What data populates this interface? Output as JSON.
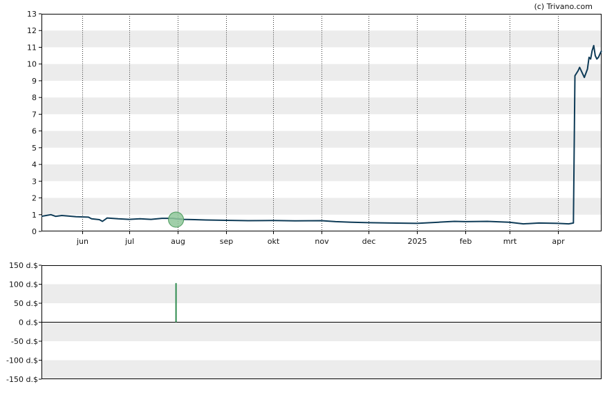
{
  "credit": "(c) Trivano.com",
  "colors": {
    "price_line": "#0d3a56",
    "marker_fill": "#8fc79a",
    "marker_stroke": "#4a9a5b",
    "volume_bar": "#2e8b4e",
    "band": "#ececec",
    "frame": "#000000",
    "month_grid": "#333333"
  },
  "chart_data": [
    {
      "type": "line",
      "ylim": [
        0,
        13
      ],
      "y_ticks": [
        "0",
        "1",
        "2",
        "3",
        "4",
        "5",
        "6",
        "7",
        "8",
        "9",
        "10",
        "11",
        "12",
        "13"
      ],
      "x_range": [
        "2024-05-06",
        "2025-04-29"
      ],
      "x_ticks": [
        {
          "label": "jun",
          "date": "2024-06-01"
        },
        {
          "label": "jul",
          "date": "2024-07-01"
        },
        {
          "label": "aug",
          "date": "2024-08-01"
        },
        {
          "label": "sep",
          "date": "2024-09-01"
        },
        {
          "label": "okt",
          "date": "2024-10-01"
        },
        {
          "label": "nov",
          "date": "2024-11-01"
        },
        {
          "label": "dec",
          "date": "2024-12-01"
        },
        {
          "label": "2025",
          "date": "2025-01-01"
        },
        {
          "label": "feb",
          "date": "2025-02-01"
        },
        {
          "label": "mrt",
          "date": "2025-03-01"
        },
        {
          "label": "apr",
          "date": "2025-04-01"
        }
      ],
      "grid": "alternating horizontal bands, dotted vertical month lines",
      "series": [
        {
          "points": [
            [
              "2024-05-06",
              0.9
            ],
            [
              "2024-05-09",
              0.95
            ],
            [
              "2024-05-12",
              1.0
            ],
            [
              "2024-05-15",
              0.9
            ],
            [
              "2024-05-19",
              0.95
            ],
            [
              "2024-05-23",
              0.92
            ],
            [
              "2024-05-28",
              0.88
            ],
            [
              "2024-06-05",
              0.85
            ],
            [
              "2024-06-07",
              0.75
            ],
            [
              "2024-06-12",
              0.7
            ],
            [
              "2024-06-14",
              0.6
            ],
            [
              "2024-06-17",
              0.8
            ],
            [
              "2024-06-24",
              0.75
            ],
            [
              "2024-07-01",
              0.72
            ],
            [
              "2024-07-08",
              0.75
            ],
            [
              "2024-07-15",
              0.72
            ],
            [
              "2024-07-22",
              0.78
            ],
            [
              "2024-07-29",
              0.78
            ],
            [
              "2024-07-31",
              0.75
            ],
            [
              "2024-08-05",
              0.72
            ],
            [
              "2024-08-12",
              0.7
            ],
            [
              "2024-08-19",
              0.68
            ],
            [
              "2024-09-01",
              0.66
            ],
            [
              "2024-09-15",
              0.64
            ],
            [
              "2024-10-01",
              0.65
            ],
            [
              "2024-10-15",
              0.63
            ],
            [
              "2024-11-01",
              0.64
            ],
            [
              "2024-11-10",
              0.58
            ],
            [
              "2024-11-20",
              0.55
            ],
            [
              "2024-12-01",
              0.52
            ],
            [
              "2024-12-15",
              0.5
            ],
            [
              "2025-01-01",
              0.48
            ],
            [
              "2025-01-15",
              0.55
            ],
            [
              "2025-01-25",
              0.6
            ],
            [
              "2025-02-01",
              0.58
            ],
            [
              "2025-02-15",
              0.6
            ],
            [
              "2025-03-01",
              0.55
            ],
            [
              "2025-03-10",
              0.45
            ],
            [
              "2025-03-20",
              0.5
            ],
            [
              "2025-04-01",
              0.48
            ],
            [
              "2025-04-08",
              0.45
            ],
            [
              "2025-04-11",
              0.5
            ],
            [
              "2025-04-12",
              9.3
            ],
            [
              "2025-04-14",
              9.6
            ],
            [
              "2025-04-15",
              9.8
            ],
            [
              "2025-04-17",
              9.4
            ],
            [
              "2025-04-18",
              9.2
            ],
            [
              "2025-04-20",
              9.7
            ],
            [
              "2025-04-21",
              10.4
            ],
            [
              "2025-04-22",
              10.3
            ],
            [
              "2025-04-23",
              10.8
            ],
            [
              "2025-04-24",
              11.1
            ],
            [
              "2025-04-25",
              10.5
            ],
            [
              "2025-04-26",
              10.3
            ],
            [
              "2025-04-27",
              10.4
            ],
            [
              "2025-04-28",
              10.6
            ],
            [
              "2025-04-29",
              10.8
            ]
          ]
        }
      ],
      "marker": {
        "date": "2024-07-31",
        "value": 0.7
      }
    },
    {
      "type": "bar",
      "ylim": [
        -150,
        150
      ],
      "y_ticks": [
        "150 d.$",
        "100 d.$",
        "50 d.$",
        "0 d.$",
        "-50 d.$",
        "-100 d.$",
        "-150 d.$"
      ],
      "bars": [
        {
          "date": "2024-07-31",
          "value": 103
        }
      ]
    }
  ]
}
